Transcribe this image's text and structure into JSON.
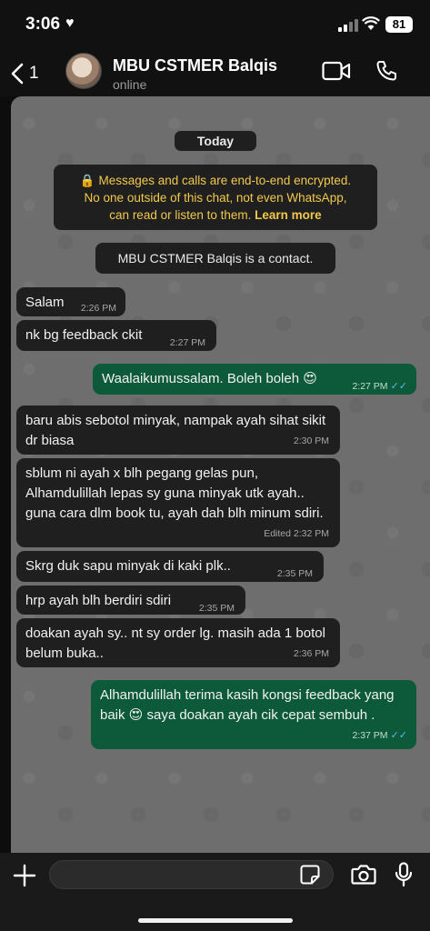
{
  "status_bar": {
    "time": "3:06",
    "battery": "81"
  },
  "header": {
    "back_count": "1",
    "contact_name": "MBU CSTMER Balqis",
    "contact_status": "online"
  },
  "system": {
    "today": "Today",
    "encryption_line1": "Messages and calls are end-to-end encrypted.",
    "encryption_line2": "No one outside of this chat, not even WhatsApp,",
    "encryption_line3": "can read or listen to them.",
    "encryption_link": "Learn more",
    "contact_notice": "MBU CSTMER Balqis is a contact."
  },
  "messages": [
    {
      "text": "Salam",
      "time": "2:26 PM",
      "dir": "in"
    },
    {
      "text": "nk bg feedback ckit",
      "time": "2:27 PM",
      "dir": "in"
    },
    {
      "text": "Waalaikumussalam. Boleh boleh 😍",
      "time": "2:27 PM",
      "dir": "out"
    },
    {
      "text": "baru abis sebotol minyak, nampak ayah sihat sikit dr biasa",
      "time": "2:30 PM",
      "dir": "in"
    },
    {
      "text": "sblum ni ayah x blh pegang gelas pun, Alhamdulillah lepas sy guna minyak utk ayah.. guna cara dlm book tu, ayah dah blh minum sdiri.",
      "time": "2:32 PM",
      "edited": "Edited",
      "dir": "in"
    },
    {
      "text": "Skrg duk sapu minyak di kaki plk..",
      "time": "2:35 PM",
      "dir": "in"
    },
    {
      "text": "hrp ayah blh berdiri sdiri",
      "time": "2:35 PM",
      "dir": "in"
    },
    {
      "text": "doakan ayah sy.. nt sy order lg. masih ada 1 botol belum buka..",
      "time": "2:36 PM",
      "dir": "in"
    },
    {
      "text": "Alhamdulillah terima kasih kongsi feedback yang baik 😍 saya doakan ayah cik cepat sembuh .",
      "time": "2:37 PM",
      "dir": "out"
    }
  ],
  "colors": {
    "incoming": "#1f1f1f",
    "outgoing": "#0d5a3a",
    "read_ticks": "#53bdeb",
    "encryption_text": "#f2c94c"
  }
}
